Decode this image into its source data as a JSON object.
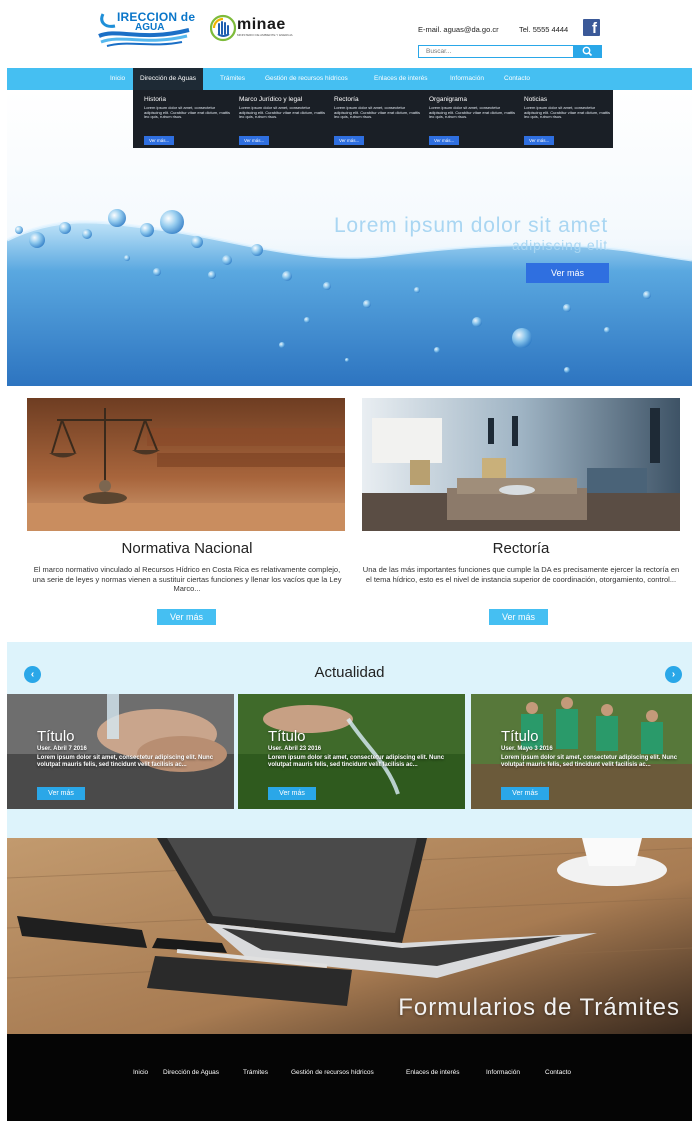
{
  "header": {
    "logo_da_line1": "IRECCION de",
    "logo_da_line2": "AGUA",
    "logo_minae": "minae",
    "logo_minae_sub": "MINISTERIO DE AMBIENTE Y ENERGIA",
    "email": "E-mail. aguas@da.go.cr",
    "phone": "Tel. 5555 4444",
    "search_placeholder": "Buscar..."
  },
  "nav": {
    "items": [
      {
        "label": "Inicio"
      },
      {
        "label": "Dirección de Aguas"
      },
      {
        "label": "Trámites"
      },
      {
        "label": "Gestión de recursos hídricos"
      },
      {
        "label": "Enlaces de interés"
      },
      {
        "label": "Información"
      },
      {
        "label": "Contacto"
      }
    ]
  },
  "dropdown": {
    "columns": [
      {
        "title": "Historia",
        "text": "Lorem ipsum dolor sit amet, consectetur adipiscing elit. Curabitur vitae erat dictum, mattis leo quis, rutrum risus.",
        "button": "Ver más..."
      },
      {
        "title": "Marco Jurídico y legal",
        "text": "Lorem ipsum dolor sit amet, consectetur adipiscing elit. Curabitur vitae erat dictum, mattis leo quis, rutrum risus.",
        "button": "Ver más..."
      },
      {
        "title": "Rectoría",
        "text": "Lorem ipsum dolor sit amet, consectetur adipiscing elit. Curabitur vitae erat dictum, mattis leo quis, rutrum risus.",
        "button": "Ver más..."
      },
      {
        "title": "Organigrama",
        "text": "Lorem ipsum dolor sit amet, consectetur adipiscing elit. Curabitur vitae erat dictum, mattis leo quis, rutrum risus.",
        "button": "Ver más..."
      },
      {
        "title": "Noticias",
        "text": "Lorem ipsum dolor sit amet, consectetur adipiscing elit. Curabitur vitae erat dictum, mattis leo quis, rutrum risus.",
        "button": "Ver más..."
      }
    ]
  },
  "hero": {
    "title": "Lorem ipsum dolor sit amet",
    "subtitle": "adipiscing elit",
    "button": "Ver más"
  },
  "cards": [
    {
      "title": "Normativa Nacional",
      "text": "El marco normativo vinculado al Recursos Hídrico en Costa Rica es relativamente complejo, una serie de leyes y normas vienen a sustituir ciertas funciones y llenar los vacíos que la Ley Marco...",
      "button": "Ver más"
    },
    {
      "title": "Rectoría",
      "text": "Una de las más importantes funciones que cumple la DA es precisamente ejercer la rectoría en el tema hídrico, esto es el nivel de instancia superior de coordinación, otorgamiento, control...",
      "button": "Ver más"
    }
  ],
  "actualidad": {
    "title": "Actualidad",
    "prev_icon": "chevron-left-icon",
    "next_icon": "chevron-right-icon",
    "news": [
      {
        "title": "Título",
        "meta": "User. Abril 7 2016",
        "text": "Lorem ipsum dolor sit amet, consectetur adipiscing elit. Nunc volutpat mauris felis, sed tincidunt velit facilisis ac...",
        "button": "Ver más"
      },
      {
        "title": "Título",
        "meta": "User. Abril 23 2016",
        "text": "Lorem ipsum dolor sit amet, consectetur adipiscing elit. Nunc volutpat mauris felis, sed tincidunt velit facilisis ac...",
        "button": "Ver más"
      },
      {
        "title": "Título",
        "meta": "User. Mayo 3 2016",
        "text": "Lorem ipsum dolor sit amet, consectetur adipiscing elit. Nunc volutpat mauris felis, sed tincidunt velit facilisis ac...",
        "button": "Ver más"
      }
    ]
  },
  "forms_banner": {
    "title": "Formularios de Trámites"
  },
  "footer": {
    "items": [
      {
        "label": "Inicio"
      },
      {
        "label": "Dirección de Aguas"
      },
      {
        "label": "Trámites"
      },
      {
        "label": "Gestión de recursos hídricos"
      },
      {
        "label": "Enlaces de interés"
      },
      {
        "label": "Información"
      },
      {
        "label": "Contacto"
      }
    ]
  },
  "colors": {
    "accent": "#45bff2",
    "accent_dark": "#2aa7e8",
    "button_blue": "#2f6fe0",
    "dropdown_bg": "#1a1f26",
    "footer_bg": "#050505",
    "section_bg": "#ddf3fb",
    "facebook": "#3b5998"
  }
}
